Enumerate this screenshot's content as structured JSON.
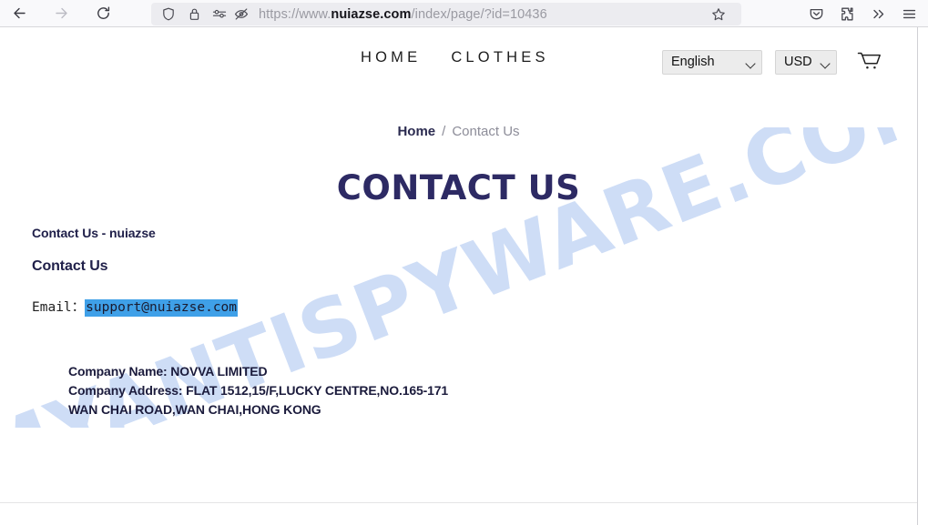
{
  "browser": {
    "back_icon": "back-arrow-icon",
    "forward_icon": "forward-arrow-icon",
    "reload_icon": "reload-icon",
    "shield_icon": "tracking-protection-shield-icon",
    "lock_icon": "padlock-icon",
    "permissions_icon": "site-permissions-icon",
    "reader_icon": "reader-mode-off-icon",
    "star_icon": "bookmark-star-icon",
    "pocket_icon": "pocket-save-icon",
    "extensions_icon": "extensions-puzzle-icon",
    "overflow_icon": "overflow-chevrons-icon",
    "menu_icon": "hamburger-menu-icon",
    "url": {
      "scheme": "https://www.",
      "host": "nuiazse.com",
      "path": "/index/page/?id=10436",
      "full": "https://www.nuiazse.com/index/page/?id=10436"
    }
  },
  "header": {
    "nav": [
      {
        "label": "HOME",
        "name": "nav-link-home"
      },
      {
        "label": "CLOTHES",
        "name": "nav-link-clothes"
      }
    ],
    "language": {
      "selected": "English",
      "options": [
        "English"
      ]
    },
    "currency": {
      "selected": "USD",
      "options": [
        "USD"
      ]
    },
    "cart_icon": "shopping-cart-icon"
  },
  "breadcrumb": {
    "home": "Home",
    "separator": "/",
    "current": "Contact Us"
  },
  "page": {
    "title": "CONTACT US",
    "intro": "Contact Us - nuiazse",
    "section_heading": "Contact Us",
    "email_label": "Email：",
    "email_value": "support@nuiazse.com",
    "company": [
      "Company Name: NOVVA LIMITED",
      "Company Address: FLAT 1512,15/F,LUCKY CENTRE,NO.165-171",
      "WAN CHAI ROAD,WAN CHAI,HONG KONG"
    ]
  },
  "watermark": {
    "text": "MYANTISPYWARE.COM",
    "color": "#ccdcf6"
  },
  "colors": {
    "title_navy": "#2d2a64",
    "selection_blue": "#3fa0e8",
    "text_dark": "#1b1b3c",
    "muted_gray": "#8d8d99"
  }
}
